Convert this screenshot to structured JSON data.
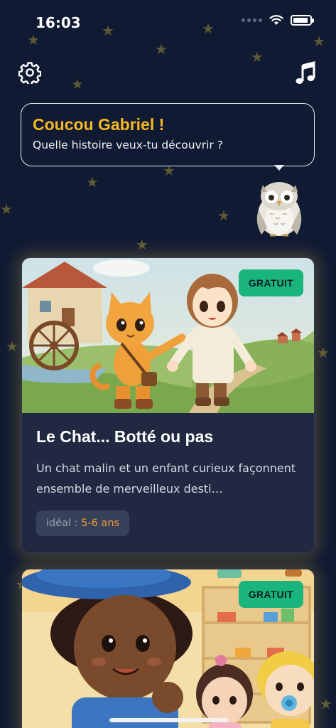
{
  "status_bar": {
    "time": "16:03"
  },
  "header": {
    "settings_icon": "gear-icon",
    "music_icon": "music-note-icon"
  },
  "greeting": {
    "title": "Coucou Gabriel !",
    "subtitle": "Quelle histoire veux-tu découvrir ?"
  },
  "stories": [
    {
      "badge": "GRATUIT",
      "title": "Le Chat... Botté ou pas",
      "description": "Un chat malin et un enfant curieux façonnent ensemble de merveilleux desti…",
      "age_label": "idéal : ",
      "age_value": "5-6 ans"
    },
    {
      "badge": "GRATUIT"
    }
  ],
  "colors": {
    "background": "#101a33",
    "accent": "#f6b81f",
    "badge": "#19b57d",
    "card": "#202941",
    "age": "#f39a3a"
  }
}
